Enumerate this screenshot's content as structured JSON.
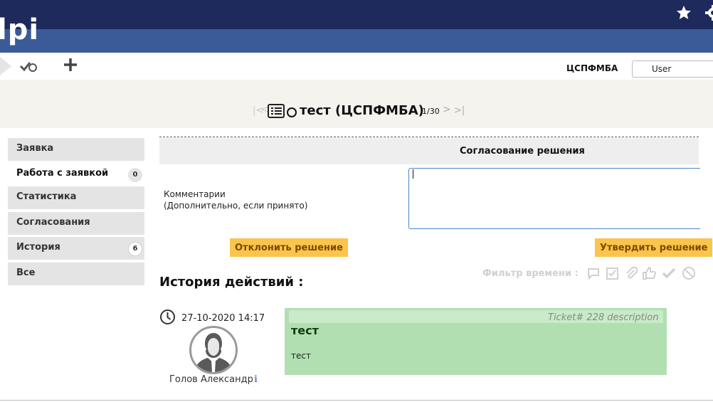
{
  "header": {
    "logo": "lpi",
    "icons": [
      "star-icon",
      "gear-icon"
    ]
  },
  "toolbar": {
    "entity": "ЦСПФМБА",
    "profile": "User",
    "icons": [
      "arrow-icon",
      "check-icon",
      "plus-icon"
    ]
  },
  "title_bar": {
    "title": "тест (ЦСПФМБА)",
    "counter": "1/30",
    "nav_first": "|<",
    "nav_prev": "<",
    "nav_next": ">",
    "nav_last": ">|"
  },
  "tabs": [
    {
      "label": "Заявка",
      "badge": null,
      "active": false
    },
    {
      "label": "Работа с заявкой",
      "badge": "0",
      "active": true
    },
    {
      "label": "Статистика",
      "badge": null,
      "active": false
    },
    {
      "label": "Согласования",
      "badge": null,
      "active": false
    },
    {
      "label": "История",
      "badge": "6",
      "active": false
    },
    {
      "label": "Все",
      "badge": null,
      "active": false
    }
  ],
  "approval": {
    "section_title": "Согласование решения",
    "comment_label_line1": "Комментарии",
    "comment_label_line2": "(Дополнительно, если принято)",
    "comment_value": "",
    "reject_label": "Отклонить решение",
    "approve_label": "Утвердить решение"
  },
  "history": {
    "title": "История действий :",
    "filter_label": "Фильтр времени :",
    "filter_icons": [
      "comment-icon",
      "task-icon",
      "attachment-icon",
      "thumbs-up-icon",
      "check-icon",
      "ban-icon"
    ],
    "entries": [
      {
        "date": "27-10-2020 14:17",
        "author": "Голов Александр",
        "meta": "Ticket# 228 description",
        "title": "тест",
        "body": "тест"
      }
    ]
  },
  "colors": {
    "header_dark": "#1d2a5b",
    "header_mid": "#3b5a98",
    "button": "#fbc44b",
    "entry_bg": "#b2dfb2"
  }
}
